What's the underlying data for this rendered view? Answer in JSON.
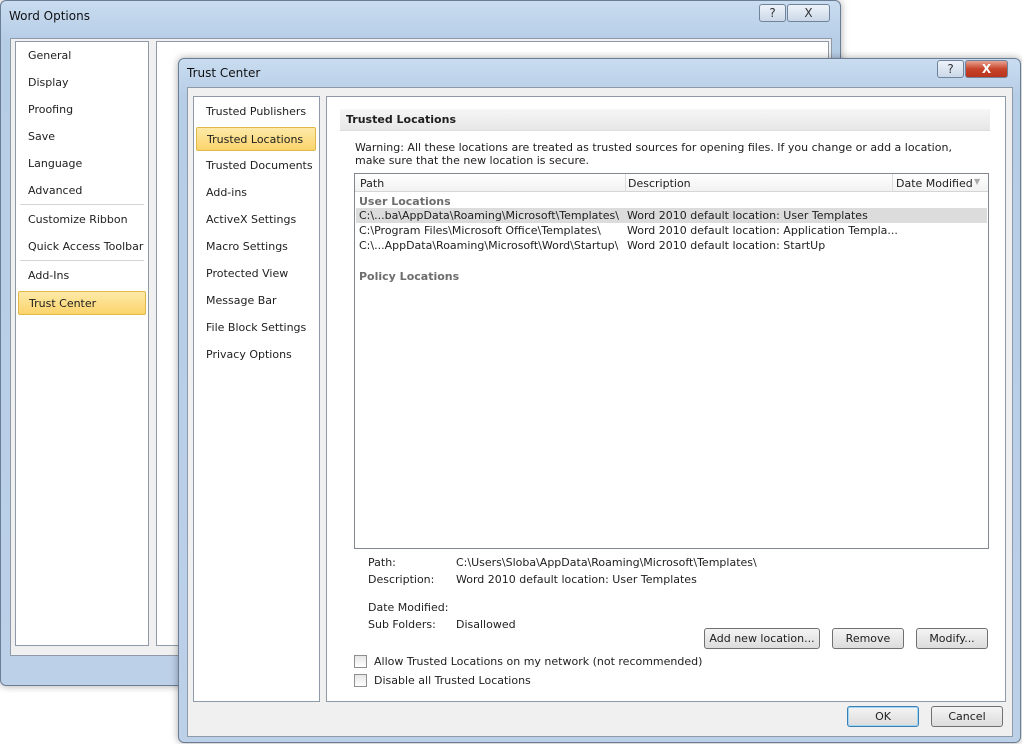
{
  "word_options": {
    "title": "Word Options",
    "help": "?",
    "close": "X",
    "nav": [
      "General",
      "Display",
      "Proofing",
      "Save",
      "Language",
      "Advanced",
      "Customize Ribbon",
      "Quick Access Toolbar",
      "Add-Ins",
      "Trust Center"
    ]
  },
  "trust_center": {
    "title": "Trust Center",
    "help": "?",
    "close": "X",
    "nav": [
      "Trusted Publishers",
      "Trusted Locations",
      "Trusted Documents",
      "Add-ins",
      "ActiveX Settings",
      "Macro Settings",
      "Protected View",
      "Message Bar",
      "File Block Settings",
      "Privacy Options"
    ],
    "section_title": "Trusted Locations",
    "warning": "Warning: All these locations are treated as trusted sources for opening files.  If you change or add a location, make sure that the new location is secure.",
    "table": {
      "columns": [
        "Path",
        "Description",
        "Date Modified"
      ],
      "user_group": "User Locations",
      "rows": [
        {
          "path": "C:\\...ba\\AppData\\Roaming\\Microsoft\\Templates\\",
          "description": "Word 2010 default location: User Templates"
        },
        {
          "path": "C:\\Program Files\\Microsoft Office\\Templates\\",
          "description": "Word 2010 default location: Application Templa..."
        },
        {
          "path": "C:\\...AppData\\Roaming\\Microsoft\\Word\\Startup\\",
          "description": "Word 2010 default location: StartUp"
        }
      ],
      "policy_group": "Policy Locations"
    },
    "details": {
      "path_label": "Path:",
      "path": "C:\\Users\\Sloba\\AppData\\Roaming\\Microsoft\\Templates\\",
      "desc_label": "Description:",
      "desc": "Word 2010 default location: User Templates",
      "date_label": "Date Modified:",
      "date": "",
      "sub_label": "Sub Folders:",
      "sub": "Disallowed"
    },
    "buttons": {
      "add": "Add new location...",
      "remove": "Remove",
      "modify": "Modify...",
      "ok": "OK",
      "cancel": "Cancel"
    },
    "checkboxes": {
      "network": "Allow Trusted Locations on my network (not recommended)",
      "disable": "Disable all Trusted Locations"
    }
  }
}
